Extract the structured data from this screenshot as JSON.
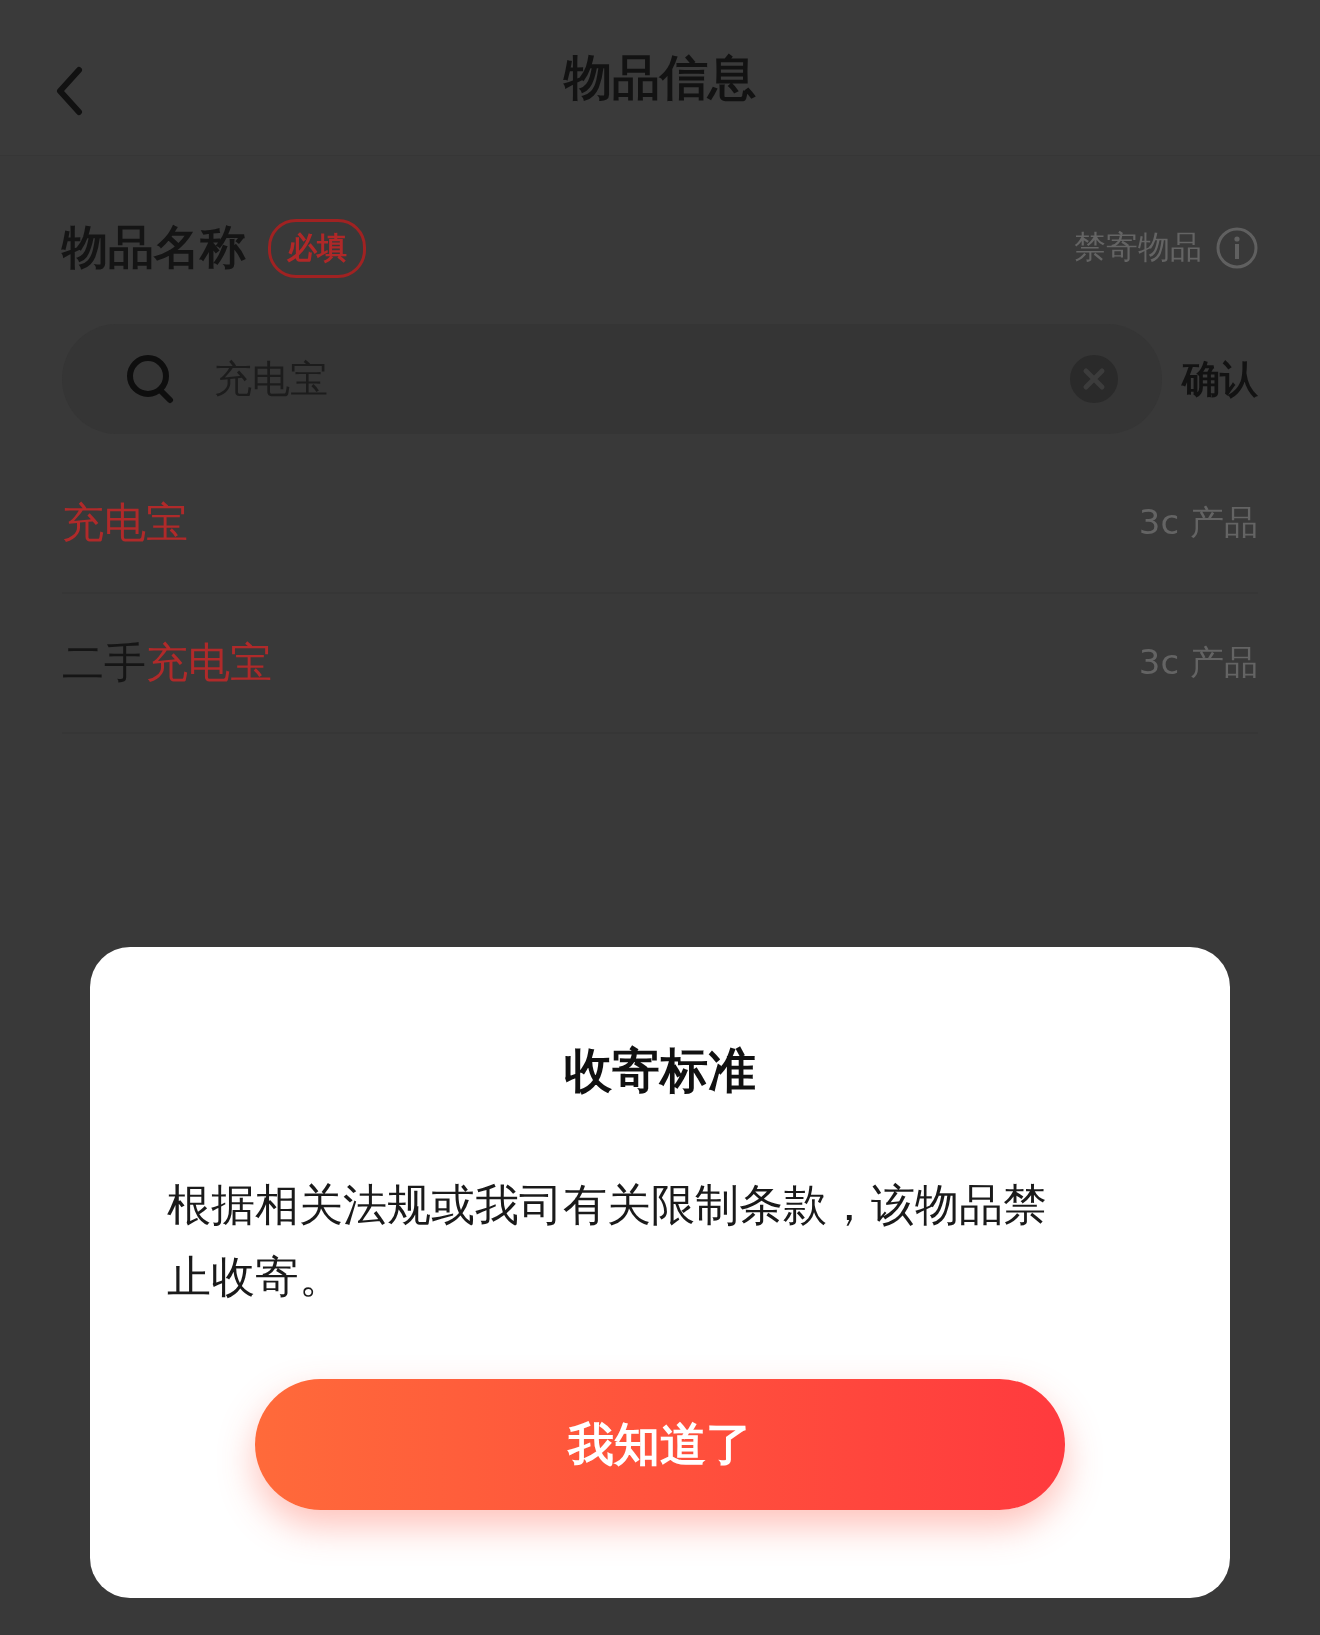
{
  "header": {
    "title": "物品信息"
  },
  "item_name": {
    "label": "物品名称",
    "required_badge": "必填",
    "prohibited_link": "禁寄物品"
  },
  "search": {
    "value": "充电宝",
    "confirm": "确认"
  },
  "suggestions": [
    {
      "parts": [
        {
          "text": "充电宝",
          "highlight": true
        }
      ],
      "category": "3c 产品"
    },
    {
      "parts": [
        {
          "text": "二手",
          "highlight": false
        },
        {
          "text": "充电宝",
          "highlight": true
        }
      ],
      "category": "3c 产品"
    }
  ],
  "dialog": {
    "title": "收寄标准",
    "message": "根据相关法规或我司有关限制条款，该物品禁止收寄。",
    "button": "我知道了"
  }
}
